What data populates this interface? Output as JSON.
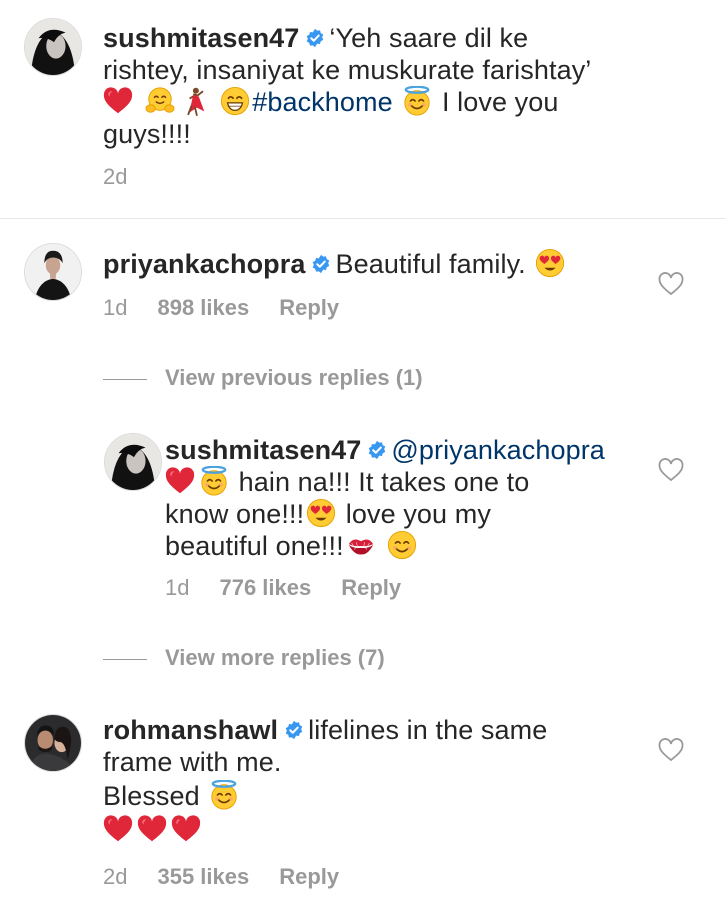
{
  "caption": {
    "username": "sushmitasen47",
    "text_line1": "‘Yeh saare dil ke",
    "text_line2": "rishtey, insaniyat ke muskurate farishtay’",
    "hashtag": "#backhome",
    "text_after_hashtag": "I love you",
    "text_line4": "guys!!!!",
    "time": "2d"
  },
  "comments": [
    {
      "username": "priyankachopra",
      "text": "Beautiful family.",
      "time": "1d",
      "likes": "898 likes",
      "reply_label": "Reply"
    },
    {
      "username": "sushmitasen47",
      "mention": "@priyankachopra",
      "text_part1": "hain na!!! It takes one to",
      "text_part2": "know one!!!",
      "text_part3": "love you my",
      "text_part4": "beautiful one!!!",
      "time": "1d",
      "likes": "776 likes",
      "reply_label": "Reply"
    },
    {
      "username": "rohmanshawl",
      "text_line1": "lifelines in the same",
      "text_line2": "frame with me.",
      "text_line3": "Blessed",
      "time": "2d",
      "likes": "355 likes",
      "reply_label": "Reply"
    }
  ],
  "view_previous_replies": "View previous replies (1)",
  "view_more_replies": "View more replies (7)",
  "icons": {
    "verified": "verified-badge-icon",
    "like": "heart-outline-icon",
    "emojis": [
      "red-heart",
      "hugging-face",
      "woman-dancing",
      "grinning-face",
      "smiling-face-with-halo",
      "heart-eyes",
      "kiss-mark",
      "smiling-face"
    ]
  },
  "colors": {
    "text": "#262626",
    "muted": "#999999",
    "verified": "#3897f0",
    "mention": "#003569",
    "heart": "#ed4956"
  }
}
